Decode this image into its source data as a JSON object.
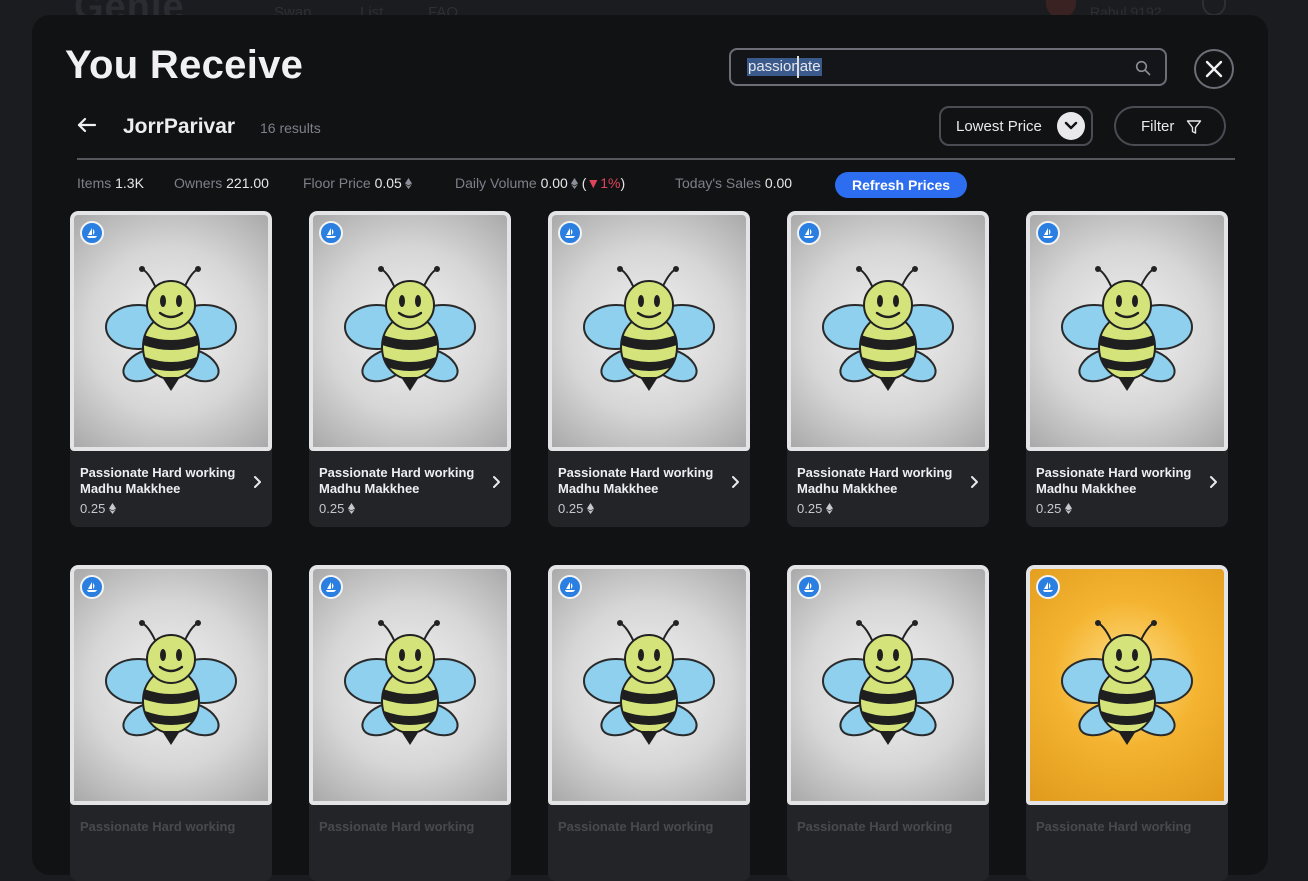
{
  "background_app": {
    "logo": "Genie",
    "nav": [
      "Swap",
      "List",
      "FAQ"
    ],
    "user": "Rahul 9192"
  },
  "modal": {
    "title": "You Receive",
    "search": {
      "value": "passionate",
      "placeholder": ""
    },
    "collection": {
      "name": "JorrParivar",
      "results": "16 results"
    },
    "sort": {
      "label": "Lowest Price"
    },
    "filter": {
      "label": "Filter"
    },
    "stats": {
      "items_label": "Items",
      "items_value": "1.3K",
      "owners_label": "Owners",
      "owners_value": "221.00",
      "floor_label": "Floor Price",
      "floor_value": "0.05",
      "volume_label": "Daily Volume",
      "volume_value": "0.00",
      "volume_change": "1%",
      "sales_label": "Today's Sales",
      "sales_value": "0.00"
    },
    "refresh_label": "Refresh Prices",
    "cards": [
      {
        "name": "Passionate Hard working Madhu Makkhee",
        "price": "0.25",
        "variant": "gray"
      },
      {
        "name": "Passionate Hard working Madhu Makkhee",
        "price": "0.25",
        "variant": "gray"
      },
      {
        "name": "Passionate Hard working Madhu Makkhee",
        "price": "0.25",
        "variant": "gray"
      },
      {
        "name": "Passionate Hard working Madhu Makkhee",
        "price": "0.25",
        "variant": "gray"
      },
      {
        "name": "Passionate Hard working Madhu Makkhee",
        "price": "0.25",
        "variant": "gray"
      },
      {
        "name": "Passionate Hard working",
        "price": "",
        "variant": "gray"
      },
      {
        "name": "Passionate Hard working",
        "price": "",
        "variant": "gray"
      },
      {
        "name": "Passionate Hard working",
        "price": "",
        "variant": "gray"
      },
      {
        "name": "Passionate Hard working",
        "price": "",
        "variant": "gray"
      },
      {
        "name": "Passionate Hard working",
        "price": "",
        "variant": "gold"
      }
    ]
  },
  "colors": {
    "accent": "#2d6ef0",
    "negative": "#e0445b",
    "badge": "#2a7fe0"
  }
}
